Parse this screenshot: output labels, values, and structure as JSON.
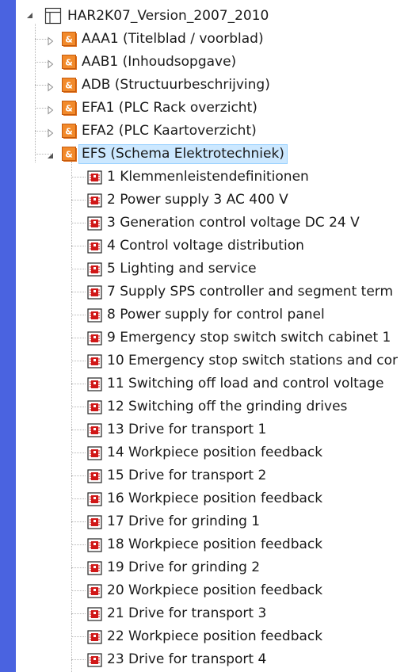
{
  "tree": {
    "root": {
      "label": "HAR2K07_Version_2007_2010",
      "icon": "project-window-icon",
      "expanded": true
    },
    "groups": [
      {
        "label": "AAA1 (Titelblad / voorblad)",
        "icon": "structure-group-icon",
        "expanded": false,
        "selected": false
      },
      {
        "label": "AAB1 (Inhoudsopgave)",
        "icon": "structure-group-icon",
        "expanded": false,
        "selected": false
      },
      {
        "label": "ADB (Structuurbeschrijving)",
        "icon": "structure-group-icon",
        "expanded": false,
        "selected": false
      },
      {
        "label": "EFA1 (PLC Rack overzicht)",
        "icon": "structure-group-icon",
        "expanded": false,
        "selected": false
      },
      {
        "label": "EFA2 (PLC Kaartoverzicht)",
        "icon": "structure-group-icon",
        "expanded": false,
        "selected": false
      },
      {
        "label": "EFS (Schema Elektrotechniek)",
        "icon": "structure-group-icon",
        "expanded": true,
        "selected": true
      }
    ],
    "pages": [
      "1 Klemmenleistendefinitionen",
      "2 Power supply 3 AC 400 V",
      "3 Generation control voltage DC 24 V",
      "4 Control voltage distribution",
      "5 Lighting and service",
      "7 Supply SPS controller and segment term",
      "8 Power supply for control panel",
      "9 Emergency stop switch switch cabinet 1",
      "10 Emergency stop switch stations and cor",
      "11 Switching off load and control voltage",
      "12 Switching off the grinding drives",
      "13 Drive for transport 1",
      "14 Workpiece position feedback",
      "15 Drive for transport 2",
      "16 Workpiece position feedback",
      "17 Drive for grinding 1",
      "18 Workpiece position feedback",
      "19 Drive for grinding 2",
      "20 Workpiece position feedback",
      "21 Drive for transport 3",
      "22 Workpiece position feedback",
      "23 Drive for transport 4"
    ],
    "page_icon": "schematic-page-icon"
  },
  "colors": {
    "left_strip": "#4a63e0",
    "selection_bg": "#cce8ff",
    "group_icon_bg": "#f28a2b",
    "page_icon_red": "#d01818",
    "text": "#1a1a1a"
  }
}
